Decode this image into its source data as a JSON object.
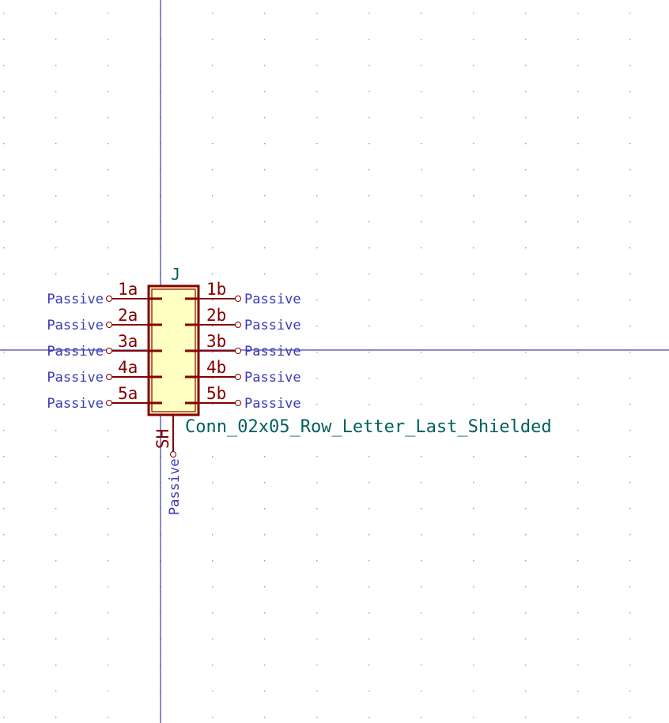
{
  "symbol": {
    "reference": "J",
    "value": "Conn_02x05_Row_Letter_Last_Shielded"
  },
  "pins": {
    "left": [
      {
        "number": "1a",
        "type": "Passive"
      },
      {
        "number": "2a",
        "type": "Passive"
      },
      {
        "number": "3a",
        "type": "Passive"
      },
      {
        "number": "4a",
        "type": "Passive"
      },
      {
        "number": "5a",
        "type": "Passive"
      }
    ],
    "right": [
      {
        "number": "1b",
        "type": "Passive"
      },
      {
        "number": "2b",
        "type": "Passive"
      },
      {
        "number": "3b",
        "type": "Passive"
      },
      {
        "number": "4b",
        "type": "Passive"
      },
      {
        "number": "5b",
        "type": "Passive"
      }
    ],
    "bottom": {
      "number": "SH",
      "type": "Passive"
    }
  },
  "colors": {
    "pin": "#840000",
    "body_fill": "#ffffc2",
    "pin_type": "#3a3ab8",
    "field_text": "#006060",
    "axis": "#1a1a8c"
  }
}
